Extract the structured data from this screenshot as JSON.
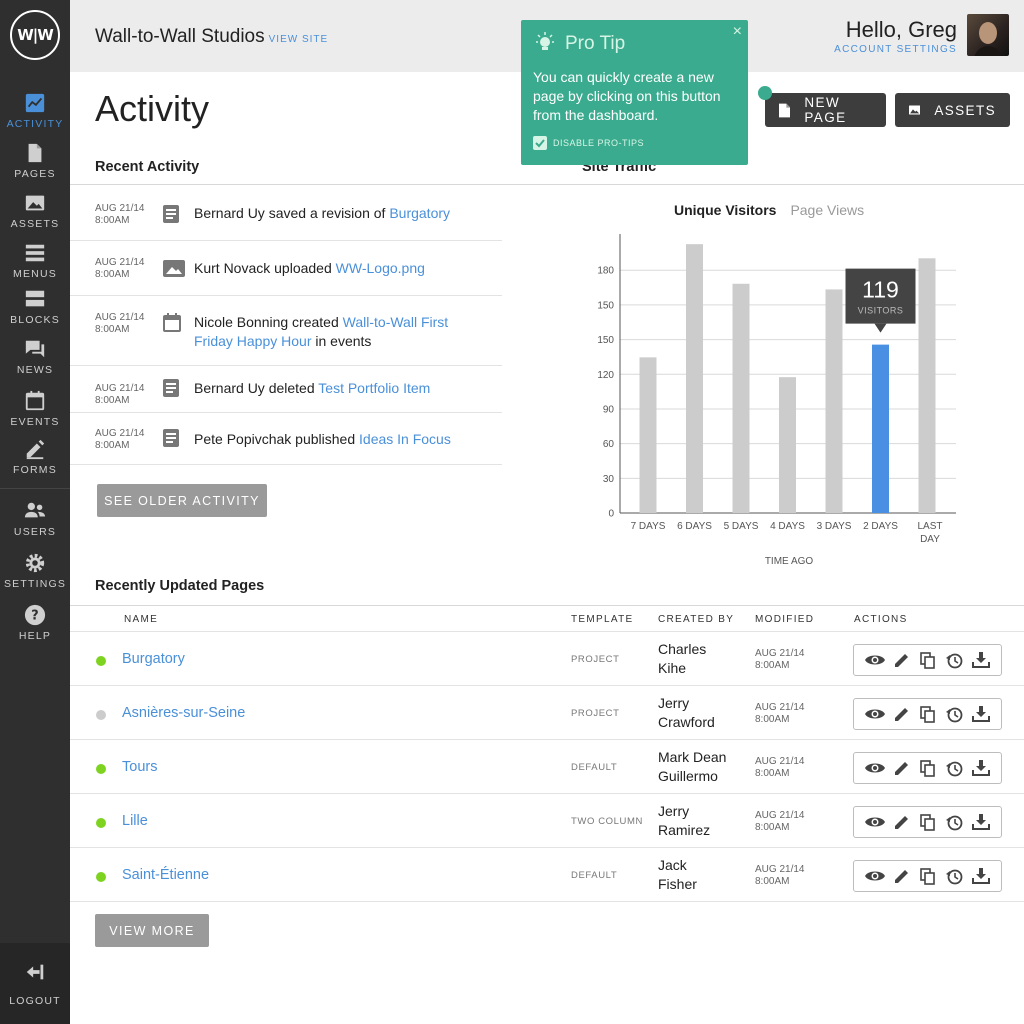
{
  "brand": {
    "logo_text": "W|W"
  },
  "sidebar": {
    "items": [
      {
        "label": "ACTIVITY",
        "icon": "activity-chart-icon",
        "active": true
      },
      {
        "label": "PAGES",
        "icon": "page-icon"
      },
      {
        "label": "ASSETS",
        "icon": "image-icon"
      },
      {
        "label": "MENUS",
        "icon": "menu-icon"
      },
      {
        "label": "BLOCKS",
        "icon": "blocks-icon"
      },
      {
        "label": "NEWS",
        "icon": "chat-icon"
      },
      {
        "label": "EVENTS",
        "icon": "calendar-icon"
      },
      {
        "label": "FORMS",
        "icon": "pencil-icon"
      },
      {
        "label": "USERS",
        "icon": "users-icon"
      },
      {
        "label": "SETTINGS",
        "icon": "gear-icon"
      },
      {
        "label": "HELP",
        "icon": "help-icon"
      }
    ],
    "logout_label": "LOGOUT"
  },
  "header": {
    "site_name": "Wall-to-Wall Studios",
    "view_site": "VIEW SITE",
    "greeting": "Hello, Greg",
    "account_settings": "ACCOUNT SETTINGS"
  },
  "page": {
    "title": "Activity",
    "new_page_label": "NEW PAGE",
    "assets_label": "ASSETS"
  },
  "protip": {
    "title": "Pro Tip",
    "text": "You can quickly create a new page by clicking on this button from the dashboard.",
    "disable_label": "DISABLE PRO-TIPS",
    "close": "×"
  },
  "recent_activity": {
    "heading": "Recent Activity",
    "items": [
      {
        "date": "AUG 21/14",
        "time": "8:00AM",
        "icon": "document-icon",
        "actor": "Bernard Uy",
        "action": " saved a revision of ",
        "target": "Burgatory",
        "suffix": ""
      },
      {
        "date": "AUG 21/14",
        "time": "8:00AM",
        "icon": "image-icon",
        "actor": "Kurt Novack",
        "action": " uploaded ",
        "target": "WW-Logo.png",
        "suffix": ""
      },
      {
        "date": "AUG 21/14",
        "time": "8:00AM",
        "icon": "calendar-icon",
        "actor": "Nicole Bonning",
        "action": " created ",
        "target": "Wall-to-Wall First Friday Happy Hour",
        "suffix": " in events"
      },
      {
        "date": "AUG 21/14",
        "time": "8:00AM",
        "icon": "document-icon",
        "actor": "Bernard Uy",
        "action": " deleted ",
        "target": "Test Portfolio Item",
        "suffix": ""
      },
      {
        "date": "AUG 21/14",
        "time": "8:00AM",
        "icon": "document-icon",
        "actor": "Pete Popivchak",
        "action": " published ",
        "target": "Ideas In Focus",
        "suffix": ""
      }
    ],
    "see_older": "SEE OLDER ACTIVITY"
  },
  "site_traffic": {
    "heading": "Site Traffic",
    "tabs": [
      "Unique Visitors",
      "Page Views"
    ],
    "tooltip": {
      "value": "119",
      "label": "VISITORS"
    }
  },
  "chart_data": {
    "type": "bar",
    "categories": [
      "7 DAYS",
      "6 DAYS",
      "5 DAYS",
      "4 DAYS",
      "3 DAYS",
      "2 DAYS",
      "LAST DAY"
    ],
    "values": [
      110,
      190,
      162,
      96,
      158,
      119,
      180
    ],
    "highlight_index": 5,
    "xlabel": "TIME AGO",
    "ylabel": "",
    "ylim": [
      0,
      200
    ],
    "yticks": [
      0,
      30,
      60,
      90,
      120,
      150,
      150,
      180
    ],
    "grid": true,
    "colors": {
      "bar": "#cccccc",
      "highlight": "#4a90e2"
    }
  },
  "pages_table": {
    "heading": "Recently Updated Pages",
    "columns": [
      "NAME",
      "TEMPLATE",
      "CREATED BY",
      "MODIFIED",
      "ACTIONS"
    ],
    "rows": [
      {
        "name": "Burgatory",
        "template": "PROJECT",
        "created_by_first": "Charles",
        "created_by_last": "Kihe",
        "date": "AUG 21/14",
        "time": "8:00AM",
        "status": "published"
      },
      {
        "name": "Asnières-sur-Seine",
        "template": "PROJECT",
        "created_by_first": "Jerry",
        "created_by_last": "Crawford",
        "date": "AUG 21/14",
        "time": "8:00AM",
        "status": "draft"
      },
      {
        "name": "Tours",
        "template": "DEFAULT",
        "created_by_first": "Mark Dean",
        "created_by_last": "Guillermo",
        "date": "AUG 21/14",
        "time": "8:00AM",
        "status": "published"
      },
      {
        "name": "Lille",
        "template": "TWO COLUMN",
        "created_by_first": "Jerry",
        "created_by_last": "Ramirez",
        "date": "AUG 21/14",
        "time": "8:00AM",
        "status": "published"
      },
      {
        "name": "Saint-Étienne",
        "template": "DEFAULT",
        "created_by_first": "Jack",
        "created_by_last": "Fisher",
        "date": "AUG 21/14",
        "time": "8:00AM",
        "status": "published"
      }
    ],
    "action_icons": [
      "eye-icon",
      "edit-icon",
      "copy-icon",
      "history-icon",
      "download-icon"
    ],
    "view_more": "VIEW MORE"
  },
  "colors": {
    "accent": "#4a90d9",
    "protip": "#3aab8e",
    "published": "#7ed321",
    "draft": "#cccccc",
    "sidebar": "#2f2f2f"
  }
}
